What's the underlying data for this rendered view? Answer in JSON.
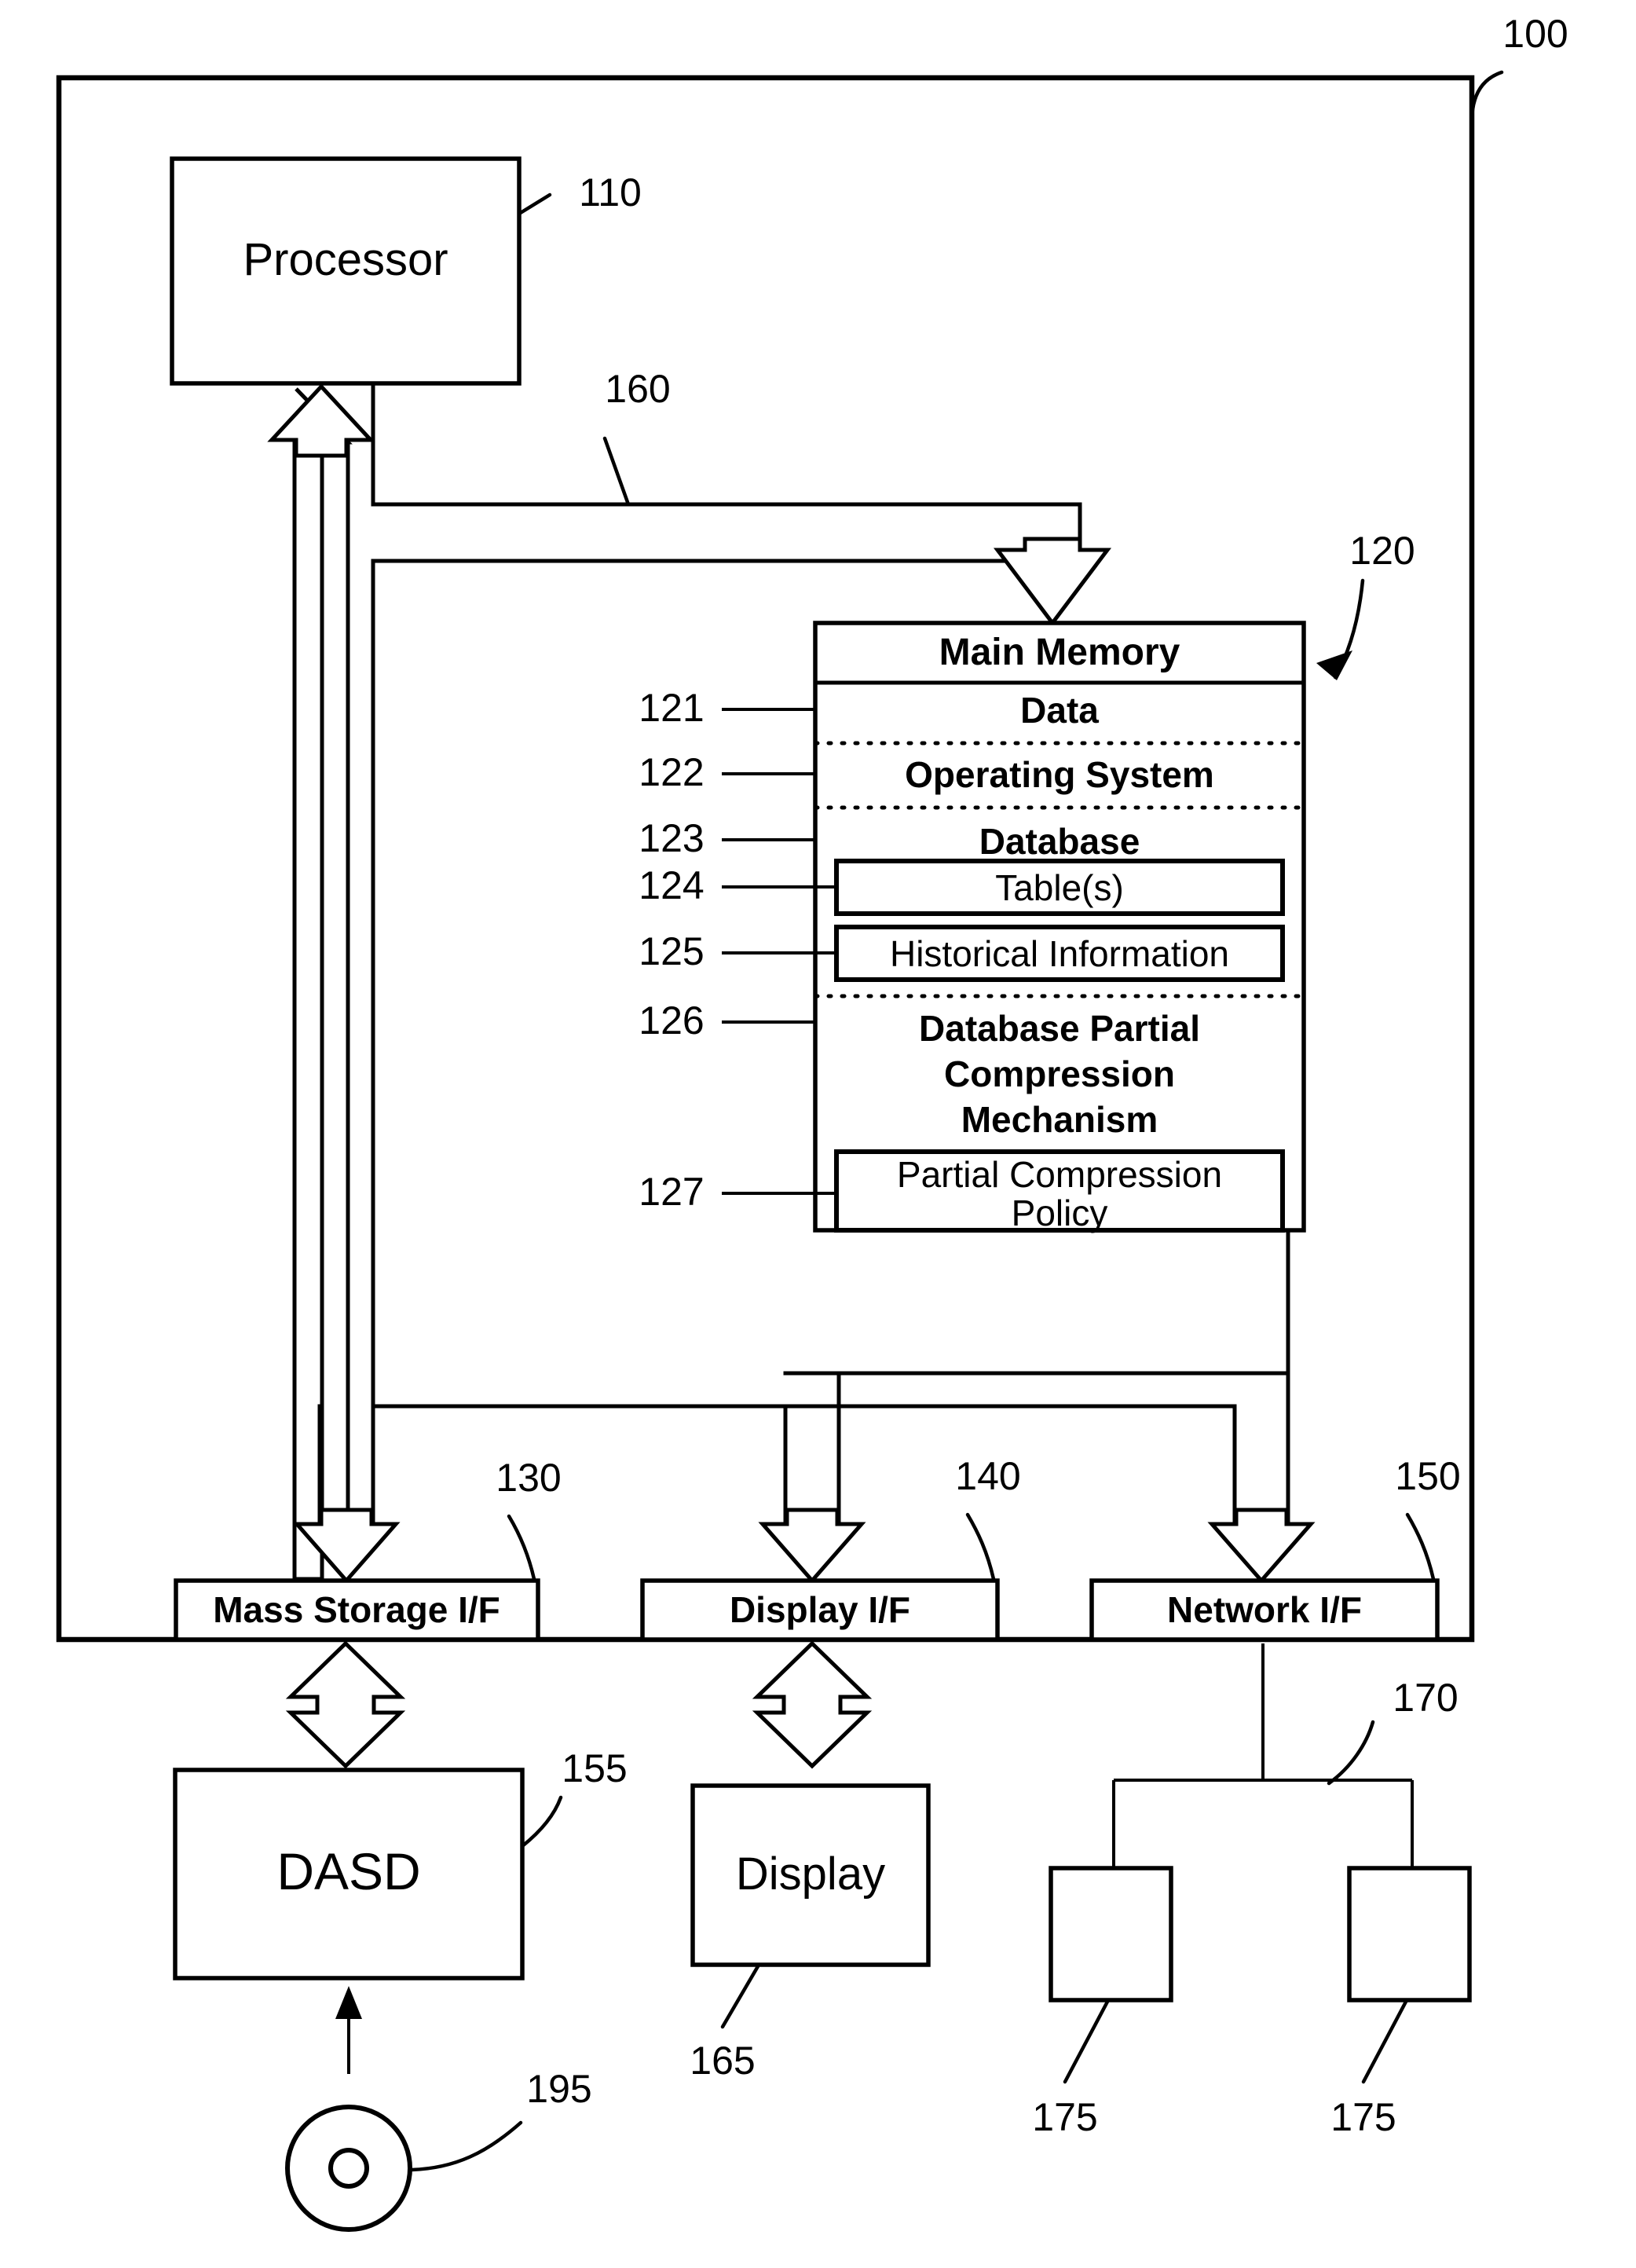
{
  "figure": {
    "system_ref": "100",
    "bus_ref": "160",
    "frame_name": "computer-system-frame"
  },
  "processor": {
    "label": "Processor",
    "ref": "110"
  },
  "main_memory": {
    "title": "Main Memory",
    "ref": "120",
    "segments": [
      {
        "ref": "121",
        "label": "Data",
        "style": "bold"
      },
      {
        "ref": "122",
        "label": "Operating System",
        "style": "bold"
      },
      {
        "ref": "123",
        "label": "Database",
        "style": "bold"
      },
      {
        "ref": "124",
        "label": "Table(s)",
        "style": "boxed"
      },
      {
        "ref": "125",
        "label": "Historical Information",
        "style": "boxed"
      },
      {
        "ref": "126",
        "label": "Database Partial Compression Mechanism",
        "style": "bold-multiline",
        "lines": [
          "Database Partial",
          "Compression",
          "Mechanism"
        ]
      },
      {
        "ref": "127",
        "label": "Partial Compression Policy",
        "style": "boxed-multiline",
        "lines": [
          "Partial Compression",
          "Policy"
        ]
      }
    ]
  },
  "interfaces": [
    {
      "label": "Mass Storage I/F",
      "ref": "130",
      "name": "mass-storage-if"
    },
    {
      "label": "Display I/F",
      "ref": "140",
      "name": "display-if"
    },
    {
      "label": "Network I/F",
      "ref": "150",
      "name": "network-if"
    }
  ],
  "peripherals": {
    "dasd": {
      "label": "DASD",
      "ref": "155"
    },
    "display": {
      "label": "Display",
      "ref": "165"
    },
    "optical_media": {
      "ref": "195",
      "icon": "disc-icon"
    },
    "network": {
      "ref": "170"
    },
    "nodes": [
      {
        "ref": "175"
      },
      {
        "ref": "175"
      }
    ]
  },
  "colors": {
    "stroke": "#000000",
    "fill": "#ffffff"
  }
}
